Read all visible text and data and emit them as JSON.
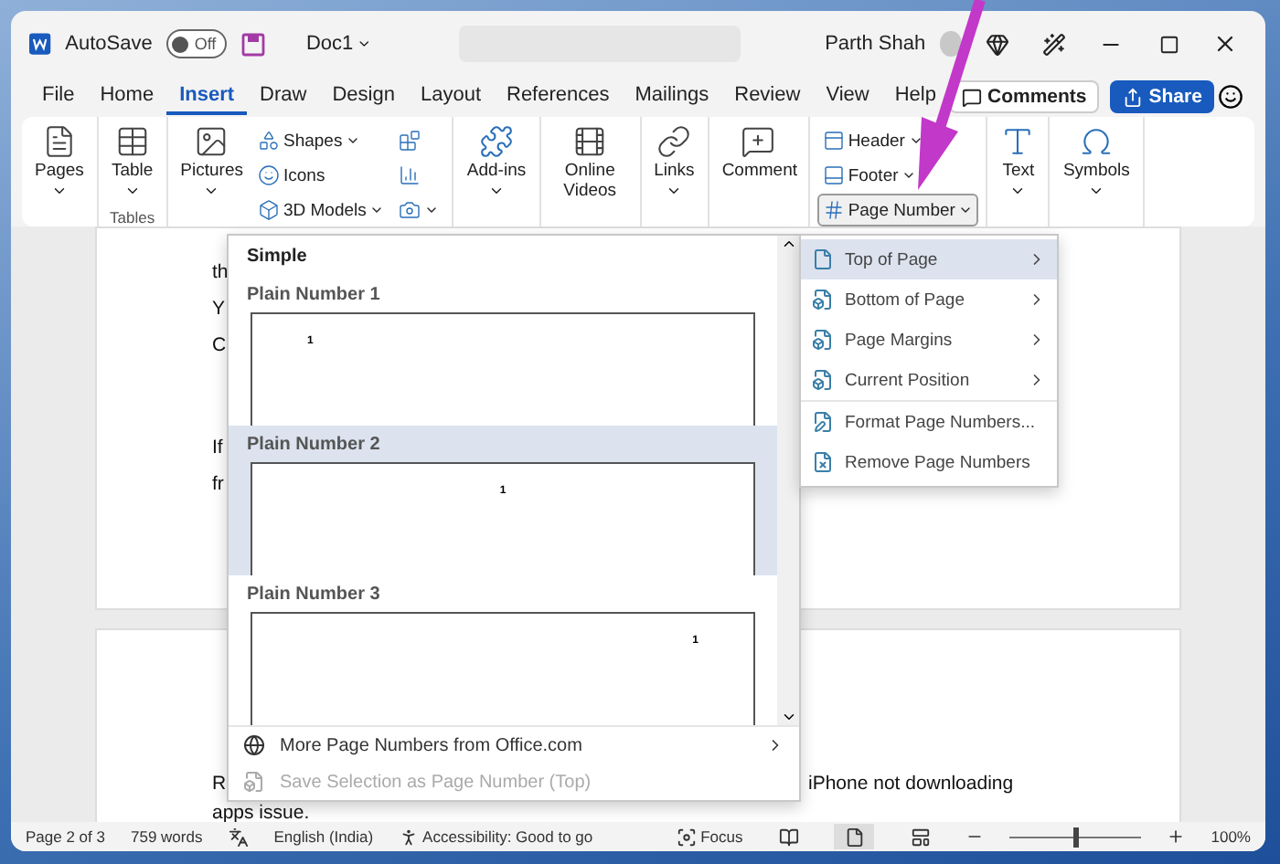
{
  "titlebar": {
    "autosave_label": "AutoSave",
    "autosave_on": false,
    "toggle_text": "Off",
    "doc_name": "Doc1",
    "user": "Parth Shah"
  },
  "menu_tabs": [
    {
      "label": "File",
      "selected": false
    },
    {
      "label": "Home",
      "selected": false
    },
    {
      "label": "Insert",
      "selected": true
    },
    {
      "label": "Draw",
      "selected": false
    },
    {
      "label": "Design",
      "selected": false
    },
    {
      "label": "Layout",
      "selected": false
    },
    {
      "label": "References",
      "selected": false
    },
    {
      "label": "Mailings",
      "selected": false
    },
    {
      "label": "Review",
      "selected": false
    },
    {
      "label": "View",
      "selected": false
    },
    {
      "label": "Help",
      "selected": false
    }
  ],
  "comments_button": "Comments",
  "share_button": "Share",
  "ribbon_groups": [
    {
      "items": [
        {
          "kind": "large",
          "label": "Pages",
          "caret": true
        }
      ]
    },
    {
      "label": "Tables",
      "items": [
        {
          "kind": "large",
          "label": "Table",
          "caret": true
        }
      ]
    },
    {
      "items": [
        {
          "kind": "large",
          "label": "Pictures",
          "caret": true
        },
        {
          "kind": "stack",
          "rows": [
            {
              "label": "Shapes",
              "caret": true
            },
            {
              "label": "Icons",
              "caret": false
            },
            {
              "label": "3D Models",
              "caret": true
            }
          ]
        },
        {
          "kind": "stack",
          "rows": [
            {
              "caret": false
            },
            {
              "caret": false
            },
            {
              "caret": true
            }
          ]
        }
      ]
    },
    {
      "items": [
        {
          "kind": "large",
          "label": "Add-ins",
          "caret": true
        }
      ]
    },
    {
      "items": [
        {
          "kind": "large",
          "label": "Online Videos",
          "caret": false
        }
      ]
    },
    {
      "items": [
        {
          "kind": "large",
          "label": "Links",
          "caret": true
        }
      ]
    },
    {
      "items": [
        {
          "kind": "large",
          "label": "Comment",
          "caret": false
        }
      ]
    },
    {
      "items": [
        {
          "kind": "stack",
          "rows": [
            {
              "label": "Header",
              "caret": true
            },
            {
              "label": "Footer",
              "caret": true
            },
            {
              "label": "Page Number",
              "caret": true,
              "pressed": true
            }
          ]
        }
      ]
    },
    {
      "items": [
        {
          "kind": "large",
          "label": "Text",
          "caret": true
        }
      ]
    },
    {
      "items": [
        {
          "kind": "large",
          "label": "Symbols",
          "caret": true
        }
      ]
    }
  ],
  "document": {
    "page_1_lines": [
      "th",
      "Y",
      "C",
      "If",
      "fr"
    ],
    "page_2_lines": [
      {
        "left": "R",
        "right": "iPhone not downloading"
      },
      {
        "left": "apps issue."
      }
    ]
  },
  "gallery": {
    "heading": "Simple",
    "items": [
      {
        "label": "Plain Number 1",
        "number": "1",
        "kind": "left",
        "selected": false
      },
      {
        "label": "Plain Number 2",
        "number": "1",
        "kind": "center",
        "selected": true
      },
      {
        "label": "Plain Number 3",
        "number": "1",
        "kind": "right",
        "selected": false
      }
    ],
    "footer": [
      {
        "label": "More Page Numbers from Office.com",
        "submenu": true,
        "disabled": false
      },
      {
        "label": "Save Selection as Page Number (Top)",
        "submenu": false,
        "disabled": true
      }
    ]
  },
  "submenu": [
    {
      "label": "Top of Page",
      "submenu": true,
      "selected": true
    },
    {
      "label": "Bottom of Page",
      "submenu": true,
      "selected": false
    },
    {
      "label": "Page Margins",
      "submenu": true,
      "selected": false
    },
    {
      "label": "Current Position",
      "submenu": true,
      "selected": false
    },
    {
      "label": "Format Page Numbers...",
      "submenu": false,
      "selected": false
    },
    {
      "label": "Remove Page Numbers",
      "submenu": false,
      "selected": false
    }
  ],
  "status_bar": {
    "page": "Page 2 of 3",
    "words": "759 words",
    "language": "English (India)",
    "accessibility": "Accessibility: Good to go",
    "focus": "Focus",
    "zoom": "100%",
    "zoom_level": {
      "level": 0.5
    }
  }
}
